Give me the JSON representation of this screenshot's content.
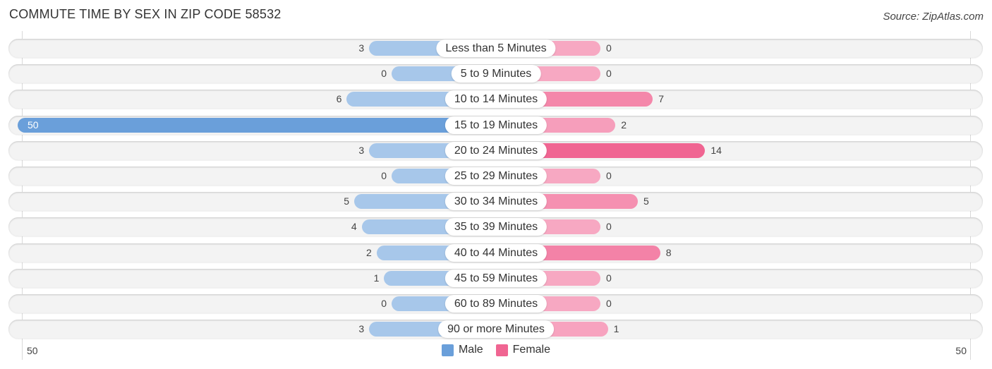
{
  "title": "COMMUTE TIME BY SEX IN ZIP CODE 58532",
  "source": "Source: ZipAtlas.com",
  "colors": {
    "male_light": "#a7c7ea",
    "male_strong": "#6a9fda",
    "female_light": "#f7a8c2",
    "female_strong": "#f06592",
    "legend_male": "#6a9fda",
    "legend_female": "#f06592"
  },
  "chart_data": {
    "type": "bar",
    "orientation": "horizontal-diverging",
    "title": "COMMUTE TIME BY SEX IN ZIP CODE 58532",
    "categories": [
      "Less than 5 Minutes",
      "5 to 9 Minutes",
      "10 to 14 Minutes",
      "15 to 19 Minutes",
      "20 to 24 Minutes",
      "25 to 29 Minutes",
      "30 to 34 Minutes",
      "35 to 39 Minutes",
      "40 to 44 Minutes",
      "45 to 59 Minutes",
      "60 to 89 Minutes",
      "90 or more Minutes"
    ],
    "series": [
      {
        "name": "Male",
        "values": [
          3,
          0,
          6,
          50,
          3,
          0,
          5,
          4,
          2,
          1,
          0,
          3
        ]
      },
      {
        "name": "Female",
        "values": [
          0,
          0,
          7,
          2,
          14,
          0,
          5,
          0,
          8,
          0,
          0,
          1
        ]
      }
    ],
    "axis_ticks": {
      "left": "50",
      "right": "50"
    },
    "xlim": [
      -50,
      50
    ],
    "legend": {
      "position": "bottom-center",
      "entries": [
        "Male",
        "Female"
      ]
    },
    "grid": false
  }
}
